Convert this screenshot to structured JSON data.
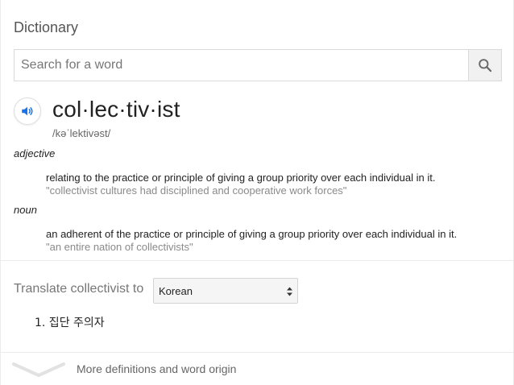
{
  "header": {
    "title": "Dictionary"
  },
  "search": {
    "placeholder": "Search for a word",
    "value": ""
  },
  "entry": {
    "word": "col·lec·tiv·ist",
    "phonetic": "/kəˈlektivəst/",
    "senses": [
      {
        "pos": "adjective",
        "definition": "relating to the practice or principle of giving a group priority over each individual in it.",
        "example": "\"collectivist cultures had disciplined and cooperative work forces\""
      },
      {
        "pos": "noun",
        "definition": "an adherent of the practice or principle of giving a group priority over each individual in it.",
        "example": "\"an entire nation of collectivists\""
      }
    ]
  },
  "translate": {
    "label": "Translate collectivist to",
    "selected_language": "Korean",
    "results": [
      "1. 집단 주의자"
    ]
  },
  "footer": {
    "more_label": "More definitions and word origin"
  },
  "icons": {
    "search": "search-icon",
    "audio": "speaker-icon",
    "select": "select-arrows-icon",
    "expand": "chevron-down-icon"
  },
  "colors": {
    "accent": "#1a73e8",
    "muted": "#777777",
    "example": "#8a8a8a"
  }
}
